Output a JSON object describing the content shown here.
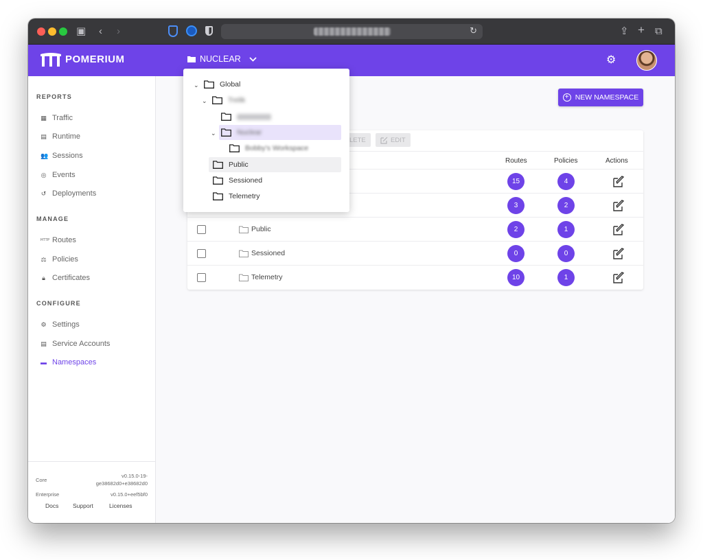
{
  "app": {
    "brand": "POMERIUM",
    "namespace_selector": "NUCLEAR"
  },
  "sidebar": {
    "sections": [
      {
        "title": "REPORTS",
        "items": [
          {
            "label": "Traffic",
            "icon": "chart-icon"
          },
          {
            "label": "Runtime",
            "icon": "server-icon"
          },
          {
            "label": "Sessions",
            "icon": "users-icon"
          },
          {
            "label": "Events",
            "icon": "broadcast-icon"
          },
          {
            "label": "Deployments",
            "icon": "history-icon"
          }
        ]
      },
      {
        "title": "MANAGE",
        "items": [
          {
            "label": "Routes",
            "icon": "http-icon"
          },
          {
            "label": "Policies",
            "icon": "gavel-icon"
          },
          {
            "label": "Certificates",
            "icon": "lock-icon"
          }
        ]
      },
      {
        "title": "CONFIGURE",
        "items": [
          {
            "label": "Settings",
            "icon": "gear-icon"
          },
          {
            "label": "Service Accounts",
            "icon": "server-icon"
          },
          {
            "label": "Namespaces",
            "icon": "folder-icon",
            "active": true
          }
        ]
      }
    ],
    "footer": {
      "core_label": "Core",
      "core_version": "v0.15.0-19-ge38682d0+e38682d0",
      "enterprise_label": "Enterprise",
      "enterprise_version": "v0.15.0+eef5bf0",
      "links": [
        "Docs",
        "Support",
        "Licenses"
      ]
    }
  },
  "main": {
    "new_namespace_button": "NEW NAMESPACE",
    "toolbar": {
      "delete_label": "LETE",
      "edit_label": "EDIT"
    },
    "table": {
      "columns": [
        "Routes",
        "Policies",
        "Actions"
      ],
      "rows": [
        {
          "name": "",
          "routes": "15",
          "policies": "4"
        },
        {
          "name": "",
          "routes": "3",
          "policies": "2"
        },
        {
          "name": "Public",
          "routes": "2",
          "policies": "1"
        },
        {
          "name": "Sessioned",
          "routes": "0",
          "policies": "0"
        },
        {
          "name": "Telemetry",
          "routes": "10",
          "policies": "1"
        }
      ]
    }
  },
  "dropdown": {
    "items": [
      {
        "label": "Global"
      },
      {
        "label": "Trelik"
      },
      {
        "label": "Nuclear"
      },
      {
        "label": "Bobby's Workspace"
      },
      {
        "label": "Public"
      },
      {
        "label": "Sessioned"
      },
      {
        "label": "Telemetry"
      }
    ]
  },
  "colors": {
    "brand_purple": "#6e43e8",
    "sidebar_bg": "#ffffff",
    "content_bg": "#f9f9fb"
  }
}
